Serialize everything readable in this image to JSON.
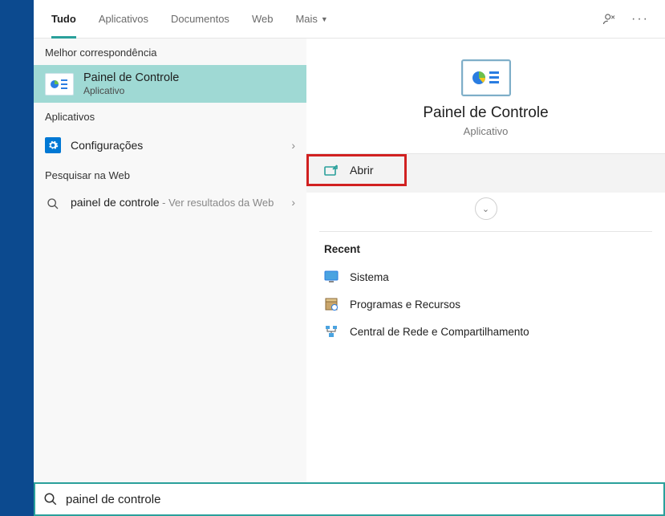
{
  "tabs": {
    "items": [
      "Tudo",
      "Aplicativos",
      "Documentos",
      "Web",
      "Mais"
    ],
    "active_index": 0
  },
  "left": {
    "best_header": "Melhor correspondência",
    "best": {
      "title": "Painel de Controle",
      "sub": "Aplicativo"
    },
    "apps_header": "Aplicativos",
    "apps": [
      {
        "label": "Configurações"
      }
    ],
    "web_header": "Pesquisar na Web",
    "web": [
      {
        "label": "painel de controle",
        "sub": " - Ver resultados da Web"
      }
    ]
  },
  "right": {
    "title": "Painel de Controle",
    "sub": "Aplicativo",
    "open_label": "Abrir",
    "recent_header": "Recent",
    "recent": [
      {
        "label": "Sistema"
      },
      {
        "label": "Programas e Recursos"
      },
      {
        "label": "Central de Rede e Compartilhamento"
      }
    ]
  },
  "search": {
    "value": "painel de controle"
  }
}
